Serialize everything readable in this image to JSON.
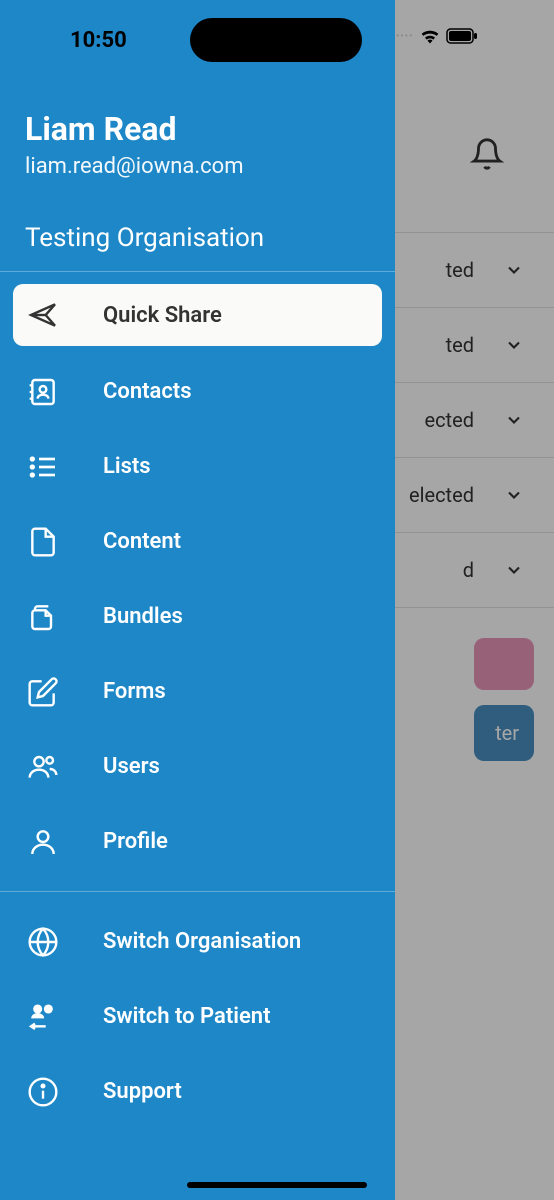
{
  "status": {
    "time": "10:50"
  },
  "drawer": {
    "user_name": "Liam Read",
    "user_email": "liam.read@iowna.com",
    "organisation": "Testing Organisation",
    "nav_primary": [
      {
        "label": "Quick Share",
        "icon": "send"
      },
      {
        "label": "Contacts",
        "icon": "contacts"
      },
      {
        "label": "Lists",
        "icon": "lists"
      },
      {
        "label": "Content",
        "icon": "file"
      },
      {
        "label": "Bundles",
        "icon": "files"
      },
      {
        "label": "Forms",
        "icon": "edit"
      },
      {
        "label": "Users",
        "icon": "users"
      },
      {
        "label": "Profile",
        "icon": "profile"
      }
    ],
    "nav_secondary": [
      {
        "label": "Switch Organisation",
        "icon": "globe"
      },
      {
        "label": "Switch to Patient",
        "icon": "switch-user"
      },
      {
        "label": "Support",
        "icon": "info"
      }
    ]
  },
  "background": {
    "rows": [
      {
        "text": "ted"
      },
      {
        "text": "ted"
      },
      {
        "text": "ected"
      },
      {
        "text": "elected"
      },
      {
        "text": "d"
      }
    ],
    "button2_partial": "ter"
  }
}
